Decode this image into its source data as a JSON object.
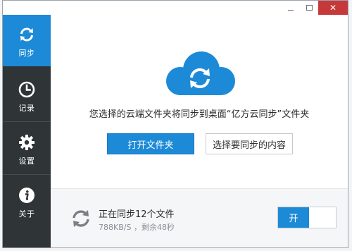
{
  "window": {
    "controls": [
      "minimize",
      "maximize",
      "close"
    ],
    "close_glyph": "✕"
  },
  "sidebar": {
    "items": [
      {
        "label": "同步",
        "icon": "sync-icon",
        "active": true
      },
      {
        "label": "记录",
        "icon": "clock-icon",
        "active": false
      },
      {
        "label": "设置",
        "icon": "gear-icon",
        "active": false
      },
      {
        "label": "关于",
        "icon": "info-icon",
        "active": false
      }
    ]
  },
  "main": {
    "cloud_icon": "cloud-sync-icon",
    "message": "您选择的云端文件夹将同步到桌面“亿方云同步”文件夹",
    "open_folder_label": "打开文件夹",
    "choose_content_label": "选择要同步的内容"
  },
  "footer": {
    "status_title": "正在同步12个文件",
    "status_sub": "788KB/S ，剩余48秒",
    "toggle_label": "开",
    "toggle_on": true
  },
  "colors": {
    "accent": "#1d8ad7",
    "sidebar_bg": "#2f3436",
    "close_btn": "#c6393a"
  }
}
